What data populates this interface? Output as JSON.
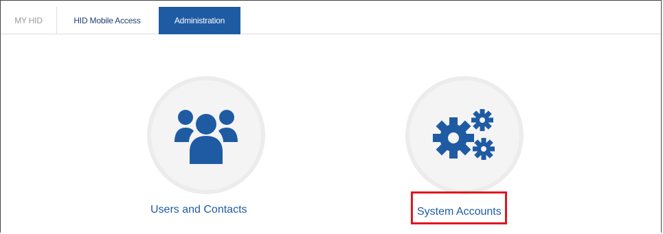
{
  "tabs": [
    {
      "label": "MY HID"
    },
    {
      "label": "HID Mobile Access"
    },
    {
      "label": "Administration"
    }
  ],
  "tiles": [
    {
      "label": "Users and Contacts",
      "icon": "users-icon"
    },
    {
      "label": "System Accounts",
      "icon": "gears-icon"
    }
  ],
  "colors": {
    "accent": "#1f5ba3",
    "highlight_border": "#e3141b"
  }
}
